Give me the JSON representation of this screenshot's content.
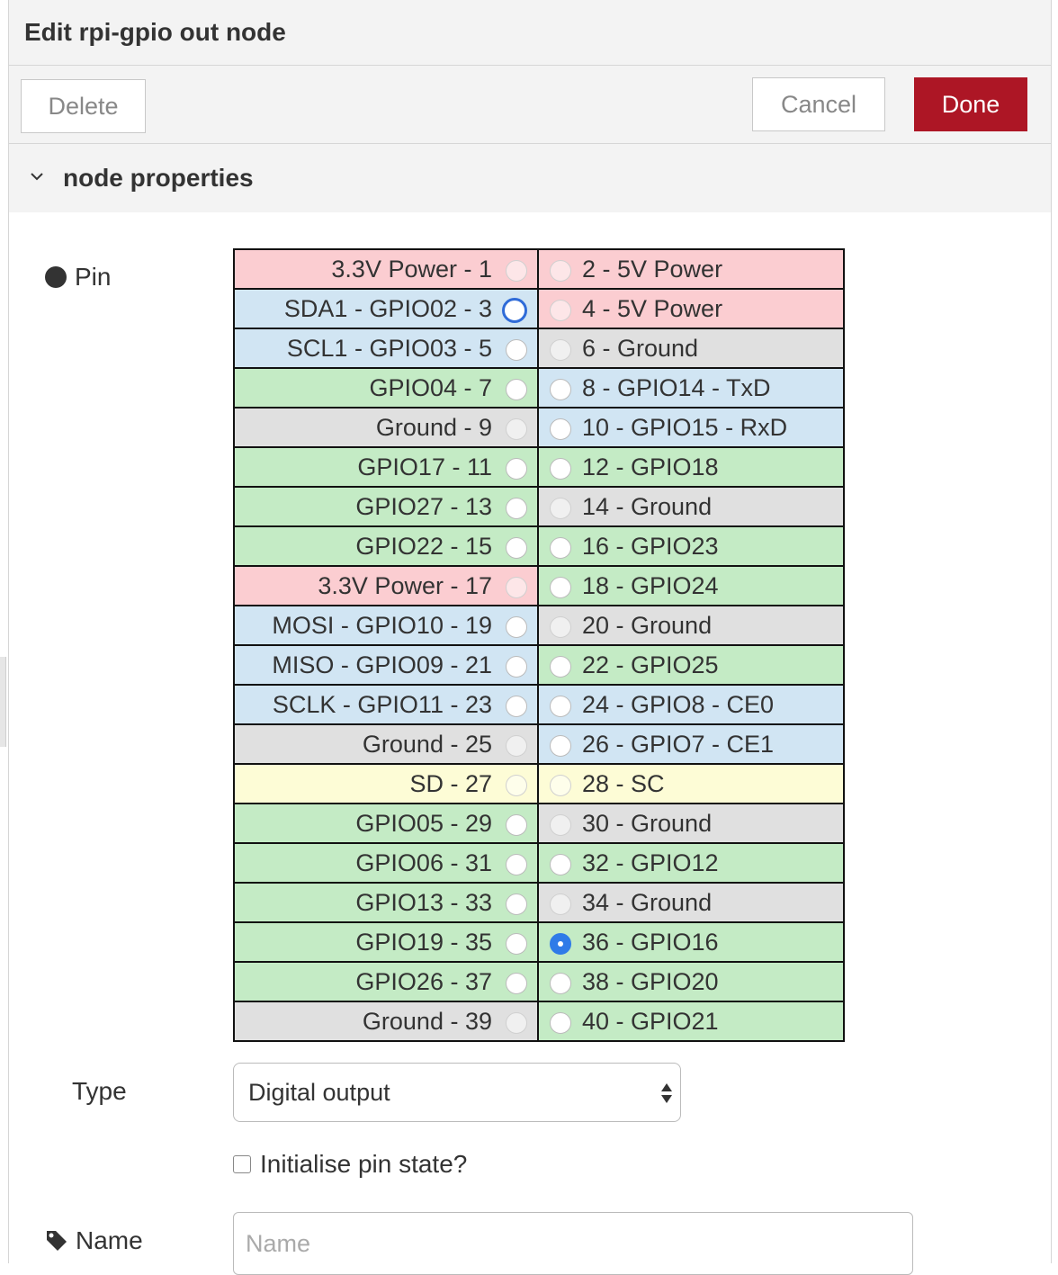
{
  "header": {
    "title": "Edit rpi-gpio out node"
  },
  "toolbar": {
    "delete_label": "Delete",
    "cancel_label": "Cancel",
    "done_label": "Done"
  },
  "section": {
    "title": "node properties",
    "expanded": true
  },
  "pin": {
    "label": "Pin",
    "selected": "36 - GPIO16",
    "rows": [
      {
        "left": "3.3V Power - 1",
        "left_type": "power",
        "right": "2 - 5V Power",
        "right_type": "power"
      },
      {
        "left": "SDA1 - GPIO02 - 3",
        "left_type": "special",
        "right": "4 - 5V Power",
        "right_type": "power"
      },
      {
        "left": "SCL1 - GPIO03 - 5",
        "left_type": "special",
        "right": "6 - Ground",
        "right_type": "ground"
      },
      {
        "left": "GPIO04 - 7",
        "left_type": "gpio",
        "right": "8 - GPIO14 - TxD",
        "right_type": "special"
      },
      {
        "left": "Ground - 9",
        "left_type": "ground",
        "right": "10 - GPIO15 - RxD",
        "right_type": "special"
      },
      {
        "left": "GPIO17 - 11",
        "left_type": "gpio",
        "right": "12 - GPIO18",
        "right_type": "gpio"
      },
      {
        "left": "GPIO27 - 13",
        "left_type": "gpio",
        "right": "14 - Ground",
        "right_type": "ground"
      },
      {
        "left": "GPIO22 - 15",
        "left_type": "gpio",
        "right": "16 - GPIO23",
        "right_type": "gpio"
      },
      {
        "left": "3.3V Power - 17",
        "left_type": "power",
        "right": "18 - GPIO24",
        "right_type": "gpio"
      },
      {
        "left": "MOSI - GPIO10 - 19",
        "left_type": "special",
        "right": "20 - Ground",
        "right_type": "ground"
      },
      {
        "left": "MISO - GPIO09 - 21",
        "left_type": "special",
        "right": "22 - GPIO25",
        "right_type": "gpio"
      },
      {
        "left": "SCLK - GPIO11 - 23",
        "left_type": "special",
        "right": "24 - GPIO8 - CE0",
        "right_type": "special"
      },
      {
        "left": "Ground - 25",
        "left_type": "ground",
        "right": "26 - GPIO7 - CE1",
        "right_type": "special"
      },
      {
        "left": "SD - 27",
        "left_type": "eeprom",
        "right": "28 - SC",
        "right_type": "eeprom"
      },
      {
        "left": "GPIO05 - 29",
        "left_type": "gpio",
        "right": "30 - Ground",
        "right_type": "ground"
      },
      {
        "left": "GPIO06 - 31",
        "left_type": "gpio",
        "right": "32 - GPIO12",
        "right_type": "gpio"
      },
      {
        "left": "GPIO13 - 33",
        "left_type": "gpio",
        "right": "34 - Ground",
        "right_type": "ground"
      },
      {
        "left": "GPIO19 - 35",
        "left_type": "gpio",
        "right": "36 - GPIO16",
        "right_type": "gpio"
      },
      {
        "left": "GPIO26 - 37",
        "left_type": "gpio",
        "right": "38 - GPIO20",
        "right_type": "gpio"
      },
      {
        "left": "Ground - 39",
        "left_type": "ground",
        "right": "40 - GPIO21",
        "right_type": "gpio"
      }
    ]
  },
  "type_field": {
    "label": "Type",
    "value": "Digital output"
  },
  "init_pin": {
    "label": "Initialise pin state?",
    "checked": false
  },
  "name_field": {
    "label": "Name",
    "placeholder": "Name",
    "value": ""
  },
  "colors": {
    "power": "#fbcdd1",
    "special": "#d1e5f3",
    "gpio": "#c4ebc5",
    "ground": "#e0e0e0",
    "eeprom": "#fdfcd6",
    "done_button": "#ad1625",
    "radio_checked": "#2f7be8"
  },
  "icons": {
    "section_toggle": "chevron-down-icon",
    "pin_label": "dot-icon",
    "name_label": "tag-icon",
    "select": "updown-arrows-icon"
  }
}
